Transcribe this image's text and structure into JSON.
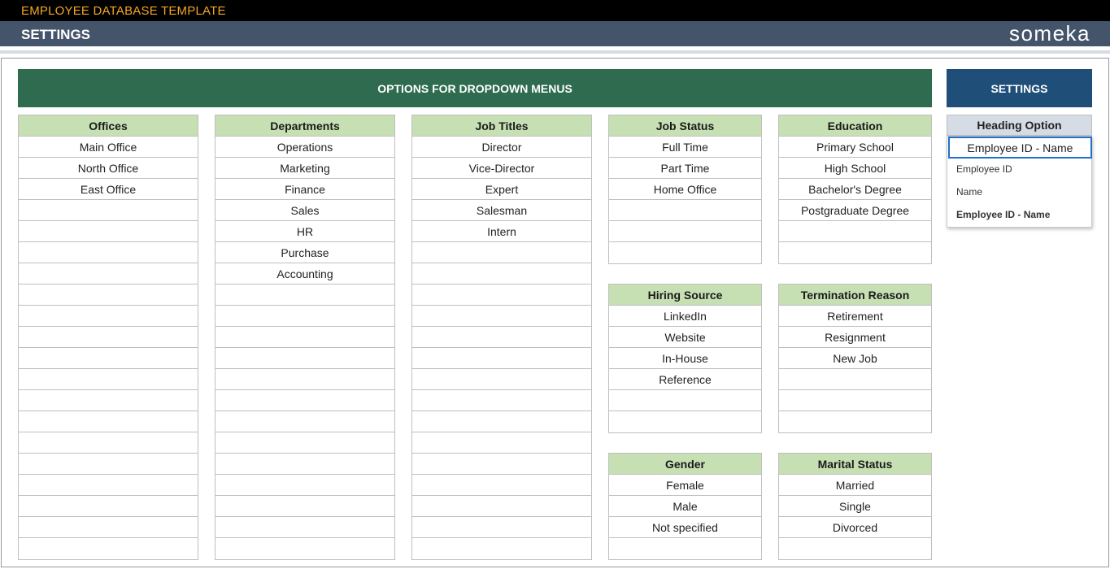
{
  "app": {
    "title": "EMPLOYEE DATABASE TEMPLATE",
    "page_title": "SETTINGS",
    "brand": "someka"
  },
  "banners": {
    "dropdown_options": "OPTIONS FOR DROPDOWN MENUS",
    "settings": "SETTINGS"
  },
  "lists": {
    "offices": {
      "header": "Offices",
      "items": [
        "Main Office",
        "North Office",
        "East Office",
        "",
        "",
        "",
        "",
        "",
        "",
        "",
        "",
        "",
        "",
        "",
        "",
        "",
        "",
        "",
        "",
        ""
      ]
    },
    "departments": {
      "header": "Departments",
      "items": [
        "Operations",
        "Marketing",
        "Finance",
        "Sales",
        "HR",
        "Purchase",
        "Accounting",
        "",
        "",
        "",
        "",
        "",
        "",
        "",
        "",
        "",
        "",
        "",
        "",
        ""
      ]
    },
    "job_titles": {
      "header": "Job Titles",
      "items": [
        "Director",
        "Vice-Director",
        "Expert",
        "Salesman",
        "Intern",
        "",
        "",
        "",
        "",
        "",
        "",
        "",
        "",
        "",
        "",
        "",
        "",
        "",
        "",
        ""
      ]
    },
    "job_status": {
      "header": "Job Status",
      "items": [
        "Full Time",
        "Part Time",
        "Home Office",
        "",
        "",
        ""
      ]
    },
    "education": {
      "header": "Education",
      "items": [
        "Primary School",
        "High School",
        "Bachelor's Degree",
        "Postgraduate Degree",
        "",
        ""
      ]
    },
    "hiring_source": {
      "header": "Hiring Source",
      "items": [
        "LinkedIn",
        "Website",
        "In-House",
        "Reference",
        "",
        ""
      ]
    },
    "termination_reason": {
      "header": "Termination Reason",
      "items": [
        "Retirement",
        "Resignment",
        "New Job",
        "",
        "",
        ""
      ]
    },
    "gender": {
      "header": "Gender",
      "items": [
        "Female",
        "Male",
        "Not specified",
        ""
      ]
    },
    "marital_status": {
      "header": "Marital Status",
      "items": [
        "Married",
        "Single",
        "Divorced",
        ""
      ]
    }
  },
  "heading_option": {
    "header": "Heading Option",
    "current_value": "Employee ID - Name",
    "options": [
      "Employee ID",
      "Name",
      "Employee ID - Name"
    ],
    "selected_index": 2
  },
  "colors": {
    "title_text": "#f5a623",
    "header_bg": "#44546a",
    "green_banner": "#2e6b4f",
    "blue_banner": "#1f4e79",
    "list_header": "#c6e0b4",
    "settings_header": "#d6dce5"
  }
}
